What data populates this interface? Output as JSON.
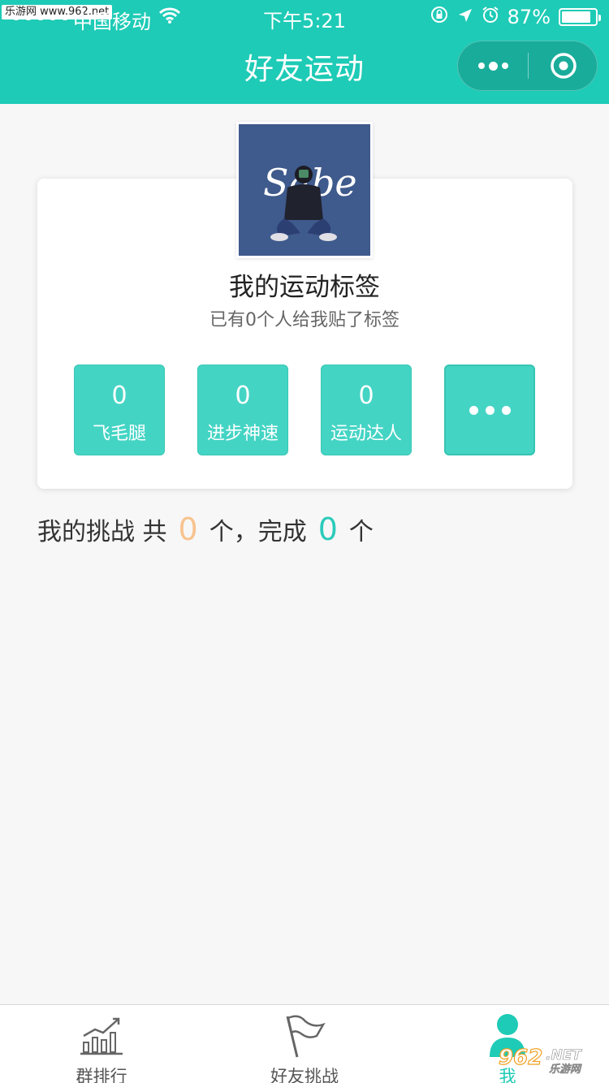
{
  "status_bar": {
    "watermark": "乐游网 www.962.net",
    "carrier": "中国移动",
    "time": "下午5:21",
    "battery": "87%",
    "battery_level": 0.87
  },
  "nav": {
    "title": "好友运动"
  },
  "profile": {
    "avatar_text": "Sabe",
    "title": "我的运动标签",
    "subtitle": "已有0个人给我贴了标签"
  },
  "tags": [
    {
      "count": "0",
      "label": "飞毛腿"
    },
    {
      "count": "0",
      "label": "进步神速"
    },
    {
      "count": "0",
      "label": "运动达人"
    }
  ],
  "challenge": {
    "prefix": "我的挑战 共",
    "total": "0",
    "middle": "个，完成",
    "done": "0",
    "suffix": "个"
  },
  "tabbar": {
    "items": [
      {
        "label": "群排行",
        "icon": "bar-chart-icon"
      },
      {
        "label": "好友挑战",
        "icon": "flag-icon"
      },
      {
        "label": "我",
        "icon": "person-icon"
      }
    ]
  },
  "colors": {
    "brand": "#1ecbb6",
    "tag": "#44d4c4",
    "orange": "#f7c38e"
  },
  "watermark_br": "962.NET 乐游网"
}
